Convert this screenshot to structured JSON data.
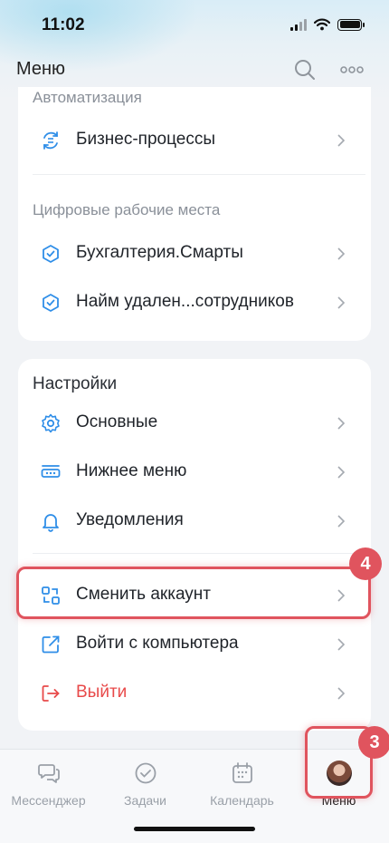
{
  "status": {
    "time": "11:02"
  },
  "header": {
    "title": "Меню"
  },
  "automation": {
    "label": "Автоматизация",
    "items": [
      {
        "label": "Бизнес-процессы"
      }
    ]
  },
  "workplaces": {
    "label": "Цифровые рабочие места",
    "items": [
      {
        "label": "Бухгалтерия.Смарты"
      },
      {
        "label": "Найм удален...сотрудников"
      }
    ]
  },
  "settings": {
    "label": "Настройки",
    "items": [
      {
        "label": "Основные"
      },
      {
        "label": "Нижнее меню"
      },
      {
        "label": "Уведомления"
      }
    ]
  },
  "account": {
    "items": [
      {
        "label": "Сменить аккаунт"
      },
      {
        "label": "Войти с компьютера"
      },
      {
        "label": "Выйти"
      }
    ]
  },
  "badges": {
    "step_account": "4",
    "step_menu": "3"
  },
  "tabbar": {
    "tabs": [
      {
        "label": "Мессенджер"
      },
      {
        "label": "Задачи"
      },
      {
        "label": "Календарь"
      },
      {
        "label": "Меню"
      }
    ]
  },
  "colors": {
    "accent": "#2f8ee8",
    "danger": "#e84a4a",
    "annotation": "#e0545e"
  }
}
